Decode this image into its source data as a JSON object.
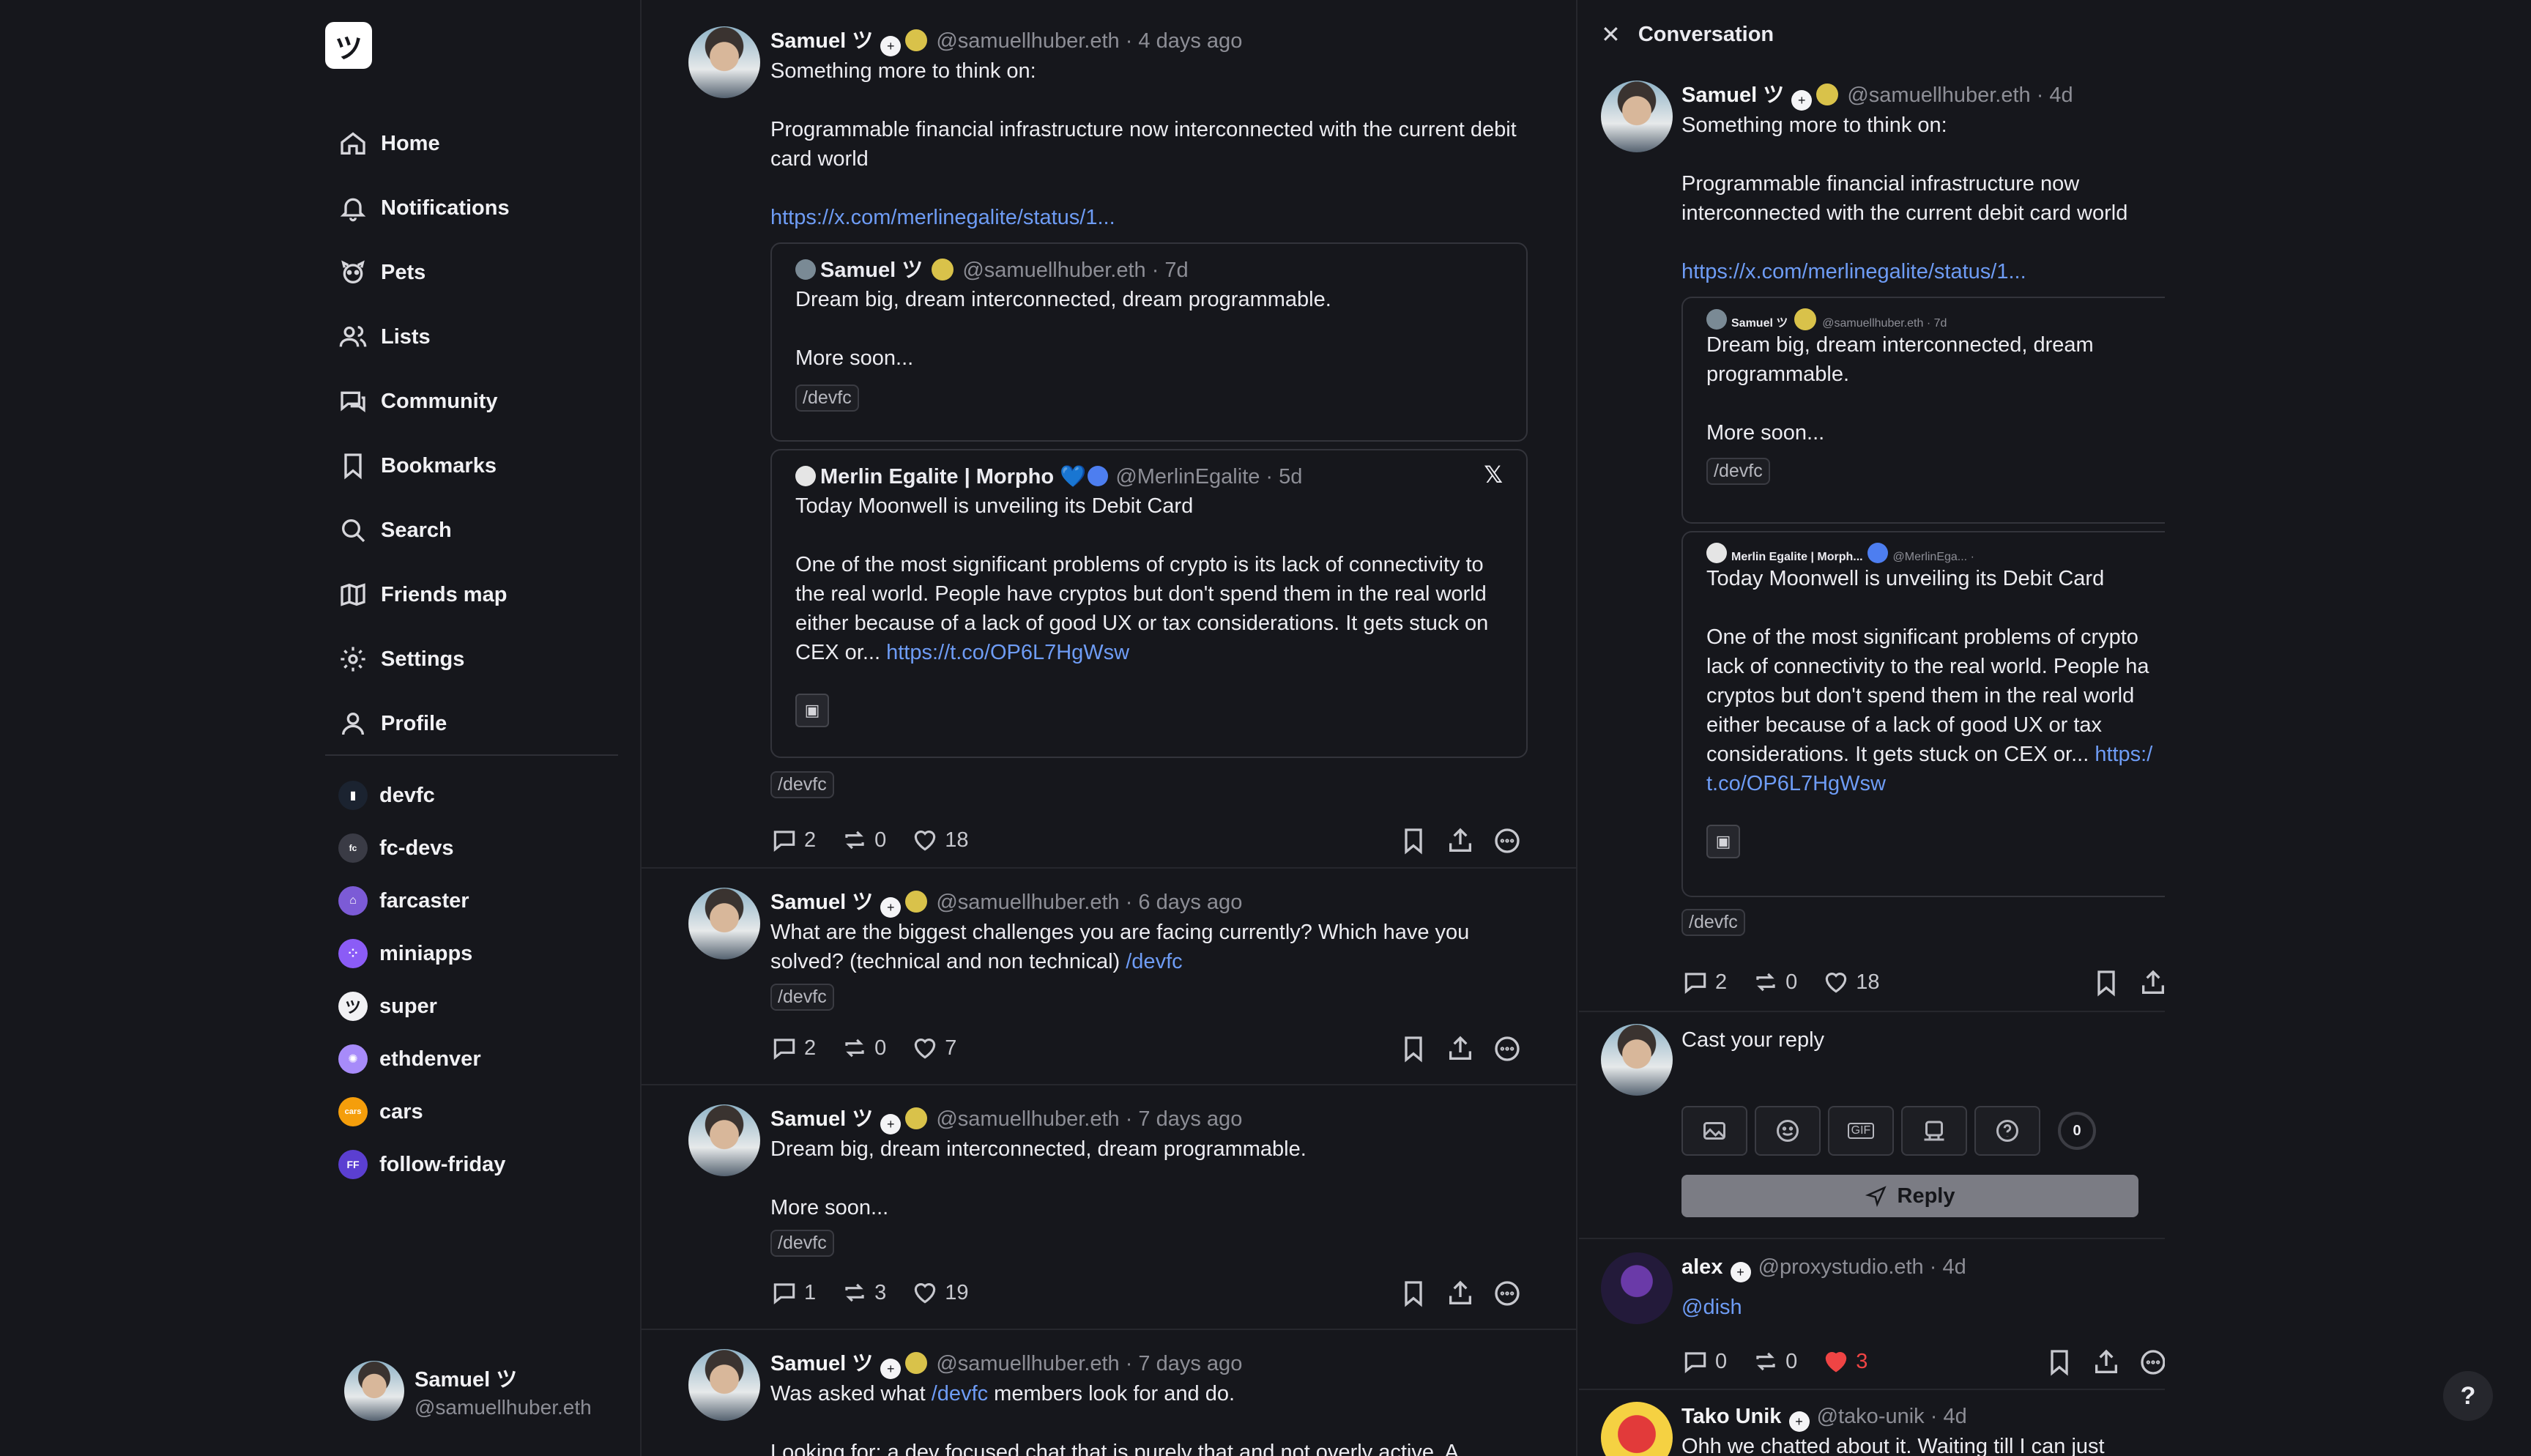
{
  "app": {
    "logo": "ツ"
  },
  "nav": [
    {
      "label": "Home",
      "icon": "home-icon"
    },
    {
      "label": "Notifications",
      "icon": "bell-icon"
    },
    {
      "label": "Pets",
      "icon": "paw-icon"
    },
    {
      "label": "Lists",
      "icon": "users-icon"
    },
    {
      "label": "Community",
      "icon": "chat-icon"
    },
    {
      "label": "Bookmarks",
      "icon": "bookmark-icon"
    },
    {
      "label": "Search",
      "icon": "search-icon"
    },
    {
      "label": "Friends map",
      "icon": "map-icon"
    },
    {
      "label": "Settings",
      "icon": "gear-icon"
    },
    {
      "label": "Profile",
      "icon": "user-icon"
    }
  ],
  "channels": [
    {
      "label": "devfc",
      "color": "#1b2330",
      "glyph": "▮"
    },
    {
      "label": "fc-devs",
      "color": "#3a3b45",
      "glyph": "fc"
    },
    {
      "label": "farcaster",
      "color": "#7c5bd6",
      "glyph": "⌂"
    },
    {
      "label": "miniapps",
      "color": "#8b5cf6",
      "glyph": "⁘"
    },
    {
      "label": "super",
      "color": "#f1f1f4",
      "glyph": "ツ"
    },
    {
      "label": "ethdenver",
      "color": "#a78bfa",
      "glyph": "✺"
    },
    {
      "label": "cars",
      "color": "#f59e0b",
      "glyph": "cars"
    },
    {
      "label": "follow-friday",
      "color": "#5b3fd1",
      "glyph": "FF"
    }
  ],
  "me": {
    "name": "Samuel ツ",
    "handle": "@samuellhuber.eth"
  },
  "feed": {
    "post1": {
      "name": "Samuel ツ",
      "handle": "@samuellhuber.eth",
      "time": "· 4 days ago",
      "text": "Something more to think on:\n\nProgrammable financial infrastructure now interconnected with the current debit card world",
      "link": "https://x.com/merlinegalite/status/1...",
      "quote1": {
        "name": "Samuel ツ",
        "handle": "@samuellhuber.eth · 7d",
        "text": "Dream big, dream interconnected, dream programmable.\n\nMore soon...",
        "tag": "/devfc"
      },
      "quote2": {
        "name": "Merlin Egalite | Morpho",
        "heart": "💙",
        "handle": "@MerlinEgalite · 5d",
        "line1": "Today Moonwell is unveiling its Debit Card",
        "text": "One of the most significant problems of crypto is its lack of connectivity to the real world. People have cryptos but don't spend them in the real world either because of a lack of good UX or tax considerations. It gets stuck on CEX or... ",
        "link": "https://t.co/OP6L7HgWsw",
        "x": "𝕏"
      },
      "tag": "/devfc",
      "replies": "2",
      "recasts": "0",
      "likes": "18"
    },
    "post2": {
      "name": "Samuel ツ",
      "handle": "@samuellhuber.eth",
      "time": "· 6 days ago",
      "text": "What are the biggest challenges you are facing currently? Which have you solved? (technical and non technical) ",
      "link": "/devfc",
      "tag": "/devfc",
      "replies": "2",
      "recasts": "0",
      "likes": "7"
    },
    "post3": {
      "name": "Samuel ツ",
      "handle": "@samuellhuber.eth",
      "time": "· 7 days ago",
      "text": "Dream big, dream interconnected, dream programmable.\n\nMore soon...",
      "tag": "/devfc",
      "replies": "1",
      "recasts": "3",
      "likes": "19"
    },
    "post4": {
      "name": "Samuel ツ",
      "handle": "@samuellhuber.eth",
      "time": "· 7 days ago",
      "text_a": "Was asked what ",
      "link": "/devfc",
      "text_b": " members look for and do.",
      "text2": "Looking for: a dev focused chat that is purely that and not overly active. A"
    }
  },
  "conversation": {
    "title": "Conversation",
    "main": {
      "name": "Samuel ツ",
      "handle": "@samuellhuber.eth · 4d",
      "text": "Something more to think on:\n\nProgrammable financial infrastructure now interconnected with the current debit card world",
      "link": "https://x.com/merlinegalite/status/1...",
      "quote1": {
        "name": "Samuel ツ",
        "handle": "@samuellhuber.eth · 7d",
        "text": "Dream big, dream interconnected, dream programmable.\n\nMore soon...",
        "tag": "/devfc"
      },
      "quote2": {
        "name": "Merlin Egalite | Morph...",
        "handle": "@MerlinEga... ·",
        "line1": "Today Moonwell is unveiling its Debit Card",
        "text": "One of the most significant problems of crypto lack of connectivity to the real world. People ha cryptos but don't spend them in the real world either because of a lack of good UX or tax considerations. It gets stuck on CEX or... ",
        "link": "https:/ t.co/OP6L7HgWsw"
      },
      "tag": "/devfc",
      "replies": "2",
      "recasts": "0",
      "likes": "18"
    },
    "reply": {
      "placeholder": "Cast your reply",
      "counter": "0",
      "button": "Reply",
      "gif": "GIF"
    },
    "comment1": {
      "name": "alex",
      "handle": "@proxystudio.eth · 4d",
      "text": "@dish",
      "replies": "0",
      "recasts": "0",
      "likes": "3"
    },
    "comment2": {
      "name": "Tako Unik",
      "handle": "@tako-unik · 4d",
      "text": "Ohh we chatted about it. Waiting till I can just"
    }
  },
  "help": "?"
}
